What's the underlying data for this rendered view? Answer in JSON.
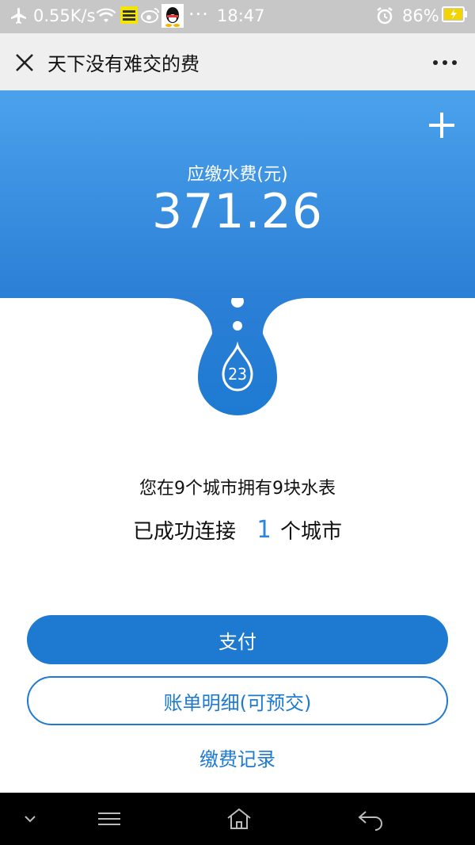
{
  "status_bar": {
    "speed": "0.55K/s",
    "time": "18:47",
    "battery": "86%"
  },
  "header": {
    "title": "天下没有难交的费"
  },
  "hero": {
    "label": "应缴水费(元)",
    "amount": "371.26"
  },
  "drop": {
    "number": "23"
  },
  "info": {
    "line1": "您在9个城市拥有9块水表",
    "line2_prefix": "已成功连接",
    "line2_count": "1",
    "line2_suffix": "个城市"
  },
  "actions": {
    "pay_label": "支付",
    "bill_label": "账单明细(可预交)",
    "record_label": "缴费记录"
  },
  "colors": {
    "accent": "#1e7ad1",
    "hero_top": "#4ba2ec",
    "hero_bottom": "#2b7fd6"
  }
}
